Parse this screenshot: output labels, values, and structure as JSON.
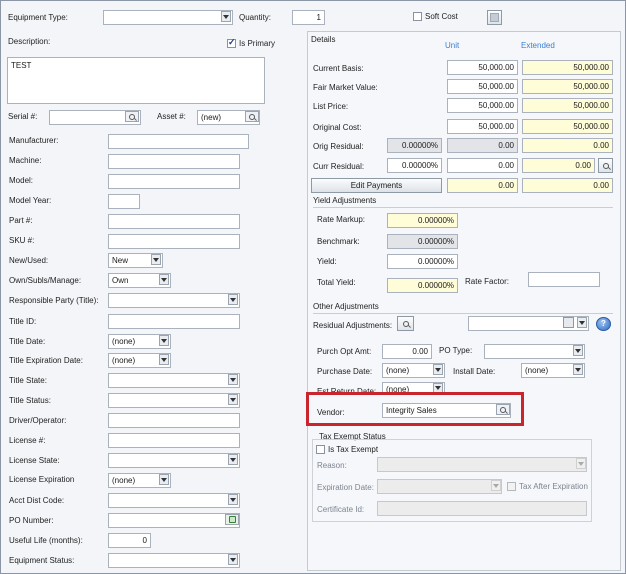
{
  "left": {
    "equipment_type": {
      "label": "Equipment Type:",
      "value": ""
    },
    "quantity": {
      "label": "Quantity:",
      "value": "1"
    },
    "soft_cost": {
      "label": "Soft Cost"
    },
    "description": {
      "label": "Description:",
      "value": "TEST"
    },
    "is_primary": {
      "label": "Is Primary"
    },
    "serial": {
      "label": "Serial #:",
      "value": ""
    },
    "asset": {
      "label": "Asset #:",
      "value": "(new)"
    },
    "manufacturer": "Manufacturer:",
    "machine": "Machine:",
    "model": "Model:",
    "model_year": "Model Year:",
    "part": "Part #:",
    "sku": "SKU #:",
    "new_used": {
      "label": "New/Used:",
      "value": "New"
    },
    "own": {
      "label": "Own/Subls/Manage:",
      "value": "Own"
    },
    "responsible_party": "Responsible Party (Title):",
    "title_id": "Title ID:",
    "title_date": {
      "label": "Title Date:",
      "value": "(none)"
    },
    "title_exp": {
      "label": "Title Expiration Date:",
      "value": "(none)"
    },
    "title_state": "Title State:",
    "title_status": "Title Status:",
    "driver": "Driver/Operator:",
    "license_no": "License #:",
    "license_state": "License State:",
    "license_exp": {
      "label": "License Expiration",
      "value": "(none)"
    },
    "acct_dist": "Acct Dist Code:",
    "po_number": "PO Number:",
    "useful_life": {
      "label": "Useful Life (months):",
      "value": "0"
    },
    "equipment_status": "Equipment Status:"
  },
  "details": {
    "title": "Details",
    "unit_header": "Unit",
    "extended_header": "Extended",
    "current_basis": {
      "label": "Current Basis:",
      "unit": "50,000.00",
      "ext": "50,000.00"
    },
    "fmv": {
      "label": "Fair Market Value:",
      "unit": "50,000.00",
      "ext": "50,000.00"
    },
    "list_price": {
      "label": "List Price:",
      "unit": "50,000.00",
      "ext": "50,000.00"
    },
    "original_cost": {
      "label": "Original Cost:",
      "unit": "50,000.00",
      "ext": "50,000.00"
    },
    "orig_residual": {
      "label": "Orig Residual:",
      "pct": "0.00000%",
      "unit": "0.00",
      "ext": "0.00"
    },
    "curr_residual": {
      "label": "Curr Residual:",
      "pct": "0.00000%",
      "unit": "0.00",
      "ext": "0.00"
    },
    "edit_payments": "Edit Payments",
    "edit_unit": "0.00",
    "edit_ext": "0.00"
  },
  "yield": {
    "title": "Yield Adjustments",
    "rate_markup": {
      "label": "Rate Markup:",
      "value": "0.00000%"
    },
    "benchmark": {
      "label": "Benchmark:",
      "value": "0.00000%"
    },
    "yield": {
      "label": "Yield:",
      "value": "0.00000%"
    },
    "total_yield": {
      "label": "Total Yield:",
      "value": "0.00000%"
    },
    "rate_factor": {
      "label": "Rate Factor:",
      "value": ""
    }
  },
  "other": {
    "title": "Other Adjustments",
    "residual_adj": "Residual Adjustments:",
    "purch_opt": {
      "label": "Purch Opt Amt:",
      "value": "0.00"
    },
    "po_type": "PO Type:",
    "purchase_date": {
      "label": "Purchase Date:",
      "value": "(none)"
    },
    "install_date": {
      "label": "Install Date:",
      "value": "(none)"
    },
    "est_return": {
      "label": "Est Return Date:",
      "value": "(none)"
    },
    "vendor": {
      "label": "Vendor:",
      "value": "Integrity Sales"
    }
  },
  "tax": {
    "title": "Tax Exempt Status",
    "is_tax_exempt": "Is Tax Exempt",
    "reason": "Reason:",
    "expiration_date": "Expiration Date:",
    "tax_after_exp": "Tax After Expiration",
    "certificate_id": "Certificate Id:"
  },
  "colors": {
    "highlight": "#c9252c",
    "yellow": "#fffcd8",
    "link": "#3a7fd5"
  }
}
